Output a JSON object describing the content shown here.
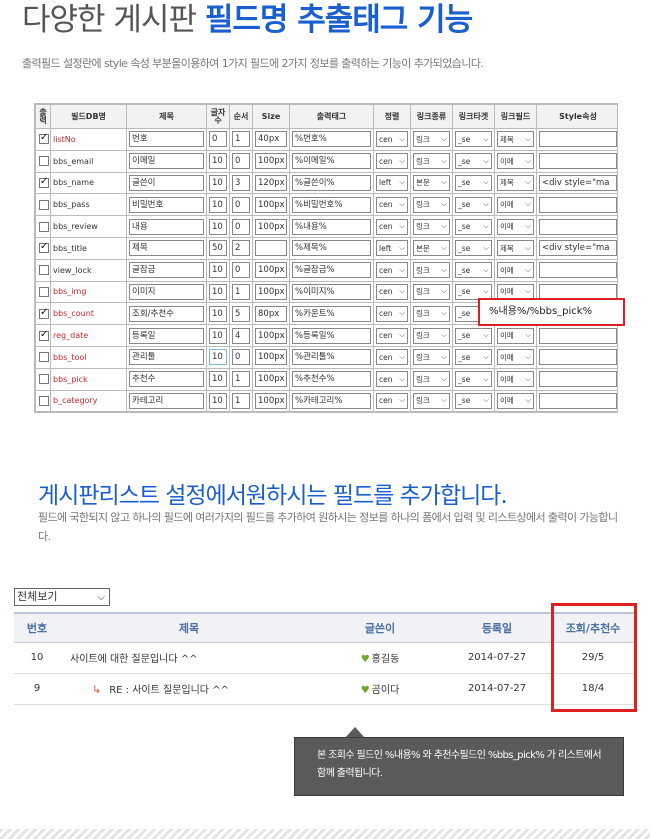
{
  "header": {
    "title_light": "다양한 게시판",
    "title_bold": "필드명 추출태그 기능",
    "description": "출력필드 설정란에 style 속성 부분을이용하여 1가지 필드에 2가지 정보를 출력하는 기능이 추가되었습니다."
  },
  "field_table": {
    "headers": [
      "출력",
      "필드DB명",
      "제목",
      "글자 수",
      "순서",
      "Size",
      "출력태그",
      "정렬",
      "링크종류",
      "링크타겟",
      "링크필드",
      "Style속성"
    ],
    "rows": [
      {
        "checked": true,
        "db": "listNo",
        "db_color": "red",
        "title": "번호",
        "len": "0",
        "order": "1",
        "size": "40px",
        "tag": "%번호%",
        "align": "cen",
        "link": "링크",
        "target": "_se",
        "field": "제목",
        "style": ""
      },
      {
        "checked": false,
        "db": "bbs_email",
        "db_color": "dark",
        "title": "이메일",
        "len": "10",
        "order": "0",
        "size": "100px",
        "tag": "%이메일%",
        "align": "cen",
        "link": "링크",
        "target": "_se",
        "field": "이메",
        "style": ""
      },
      {
        "checked": true,
        "db": "bbs_name",
        "db_color": "dark",
        "title": "글쓴이",
        "len": "10",
        "order": "3",
        "size": "120px",
        "tag": "%글쓴이%",
        "align": "left",
        "link": "본문",
        "target": "_se",
        "field": "제목",
        "style": "<div style=\"ma"
      },
      {
        "checked": false,
        "db": "bbs_pass",
        "db_color": "dark",
        "title": "비밀번호",
        "len": "10",
        "order": "0",
        "size": "100px",
        "tag": "%비밀번호%",
        "align": "cen",
        "link": "링크",
        "target": "_se",
        "field": "이메",
        "style": ""
      },
      {
        "checked": false,
        "db": "bbs_review",
        "db_color": "dark",
        "title": "내용",
        "len": "10",
        "order": "0",
        "size": "100px",
        "tag": "%내용%",
        "align": "cen",
        "link": "링크",
        "target": "_se",
        "field": "이메",
        "style": ""
      },
      {
        "checked": true,
        "db": "bbs_title",
        "db_color": "dark",
        "title": "제목",
        "len": "50",
        "order": "2",
        "size": "",
        "tag": "%제목%",
        "align": "left",
        "link": "본문",
        "target": "_se",
        "field": "제목",
        "style": "<div style=\"ma"
      },
      {
        "checked": false,
        "db": "view_lock",
        "db_color": "dark",
        "title": "글잠금",
        "len": "10",
        "order": "0",
        "size": "100px",
        "tag": "%글잠금%",
        "align": "cen",
        "link": "링크",
        "target": "_se",
        "field": "이메",
        "style": ""
      },
      {
        "checked": false,
        "db": "bbs_img",
        "db_color": "red",
        "title": "이미지",
        "len": "10",
        "order": "1",
        "size": "100px",
        "tag": "%이미지%",
        "align": "cen",
        "link": "링크",
        "target": "_se",
        "field": "이메",
        "style": ""
      },
      {
        "checked": true,
        "db": "bbs_count",
        "db_color": "red",
        "title": "조회/추천수",
        "len": "10",
        "order": "5",
        "size": "80px",
        "tag": "%카운트%",
        "align": "cen",
        "link": "링크",
        "target": "_se",
        "field": "",
        "style": ""
      },
      {
        "checked": true,
        "db": "reg_date",
        "db_color": "red",
        "title": "등록일",
        "len": "10",
        "order": "4",
        "size": "100px",
        "tag": "%등록일%",
        "align": "cen",
        "link": "링크",
        "target": "_se",
        "field": "이메",
        "style": ""
      },
      {
        "checked": false,
        "db": "bbs_tool",
        "db_color": "red",
        "title": "관리툴",
        "len": "10",
        "order": "0",
        "size": "100px",
        "tag": "%관리툴%",
        "align": "cen",
        "link": "링크",
        "target": "_se",
        "field": "이메",
        "style": ""
      },
      {
        "checked": false,
        "db": "bbs_pick",
        "db_color": "red",
        "title": "추천수",
        "len": "10",
        "order": "1",
        "size": "100px",
        "tag": "%추천수%",
        "align": "cen",
        "link": "링크",
        "target": "_se",
        "field": "이메",
        "style": ""
      },
      {
        "checked": false,
        "db": "b_category",
        "db_color": "red",
        "title": "카테고리",
        "len": "10",
        "order": "1",
        "size": "100px",
        "tag": "%카테고리%",
        "align": "cen",
        "link": "링크",
        "target": "_se",
        "field": "이메",
        "style": ""
      }
    ],
    "callout": "%내용%/%bbs_pick%"
  },
  "section2": {
    "title": "게시판리스트 설정에서원하시는 필드를 추가합니다.",
    "description": "필드에 국한되지 않고 하나의 필드에 여러가지의 필드를 추가하여 원하시는 정보를 하나의 폼에서 입력 및 리스트상에서 출력이 가능합니다."
  },
  "list": {
    "view_select": "전체보기",
    "columns": [
      "번호",
      "제목",
      "글쓴이",
      "등록일",
      "조회/추천수"
    ],
    "rows": [
      {
        "no": "10",
        "title": "사이트에 대한 질문입니다 ^^",
        "reply": false,
        "author": "홍길동",
        "date": "2014-07-27",
        "count": "29/5"
      },
      {
        "no": "9",
        "title": "RE : 사이트 질문입니다 ^^",
        "reply": true,
        "author": "곰이다",
        "date": "2014-07-27",
        "count": "18/4"
      }
    ]
  },
  "tooltip": "본 조회수 필드인 %내용% 와 추천수필드인 %bbs_pick% 가 리스트에서 함께 출력됩니다.",
  "colors": {
    "accent": "#1a5fd0",
    "highlight": "#e02020",
    "field_red": "#c62828"
  }
}
